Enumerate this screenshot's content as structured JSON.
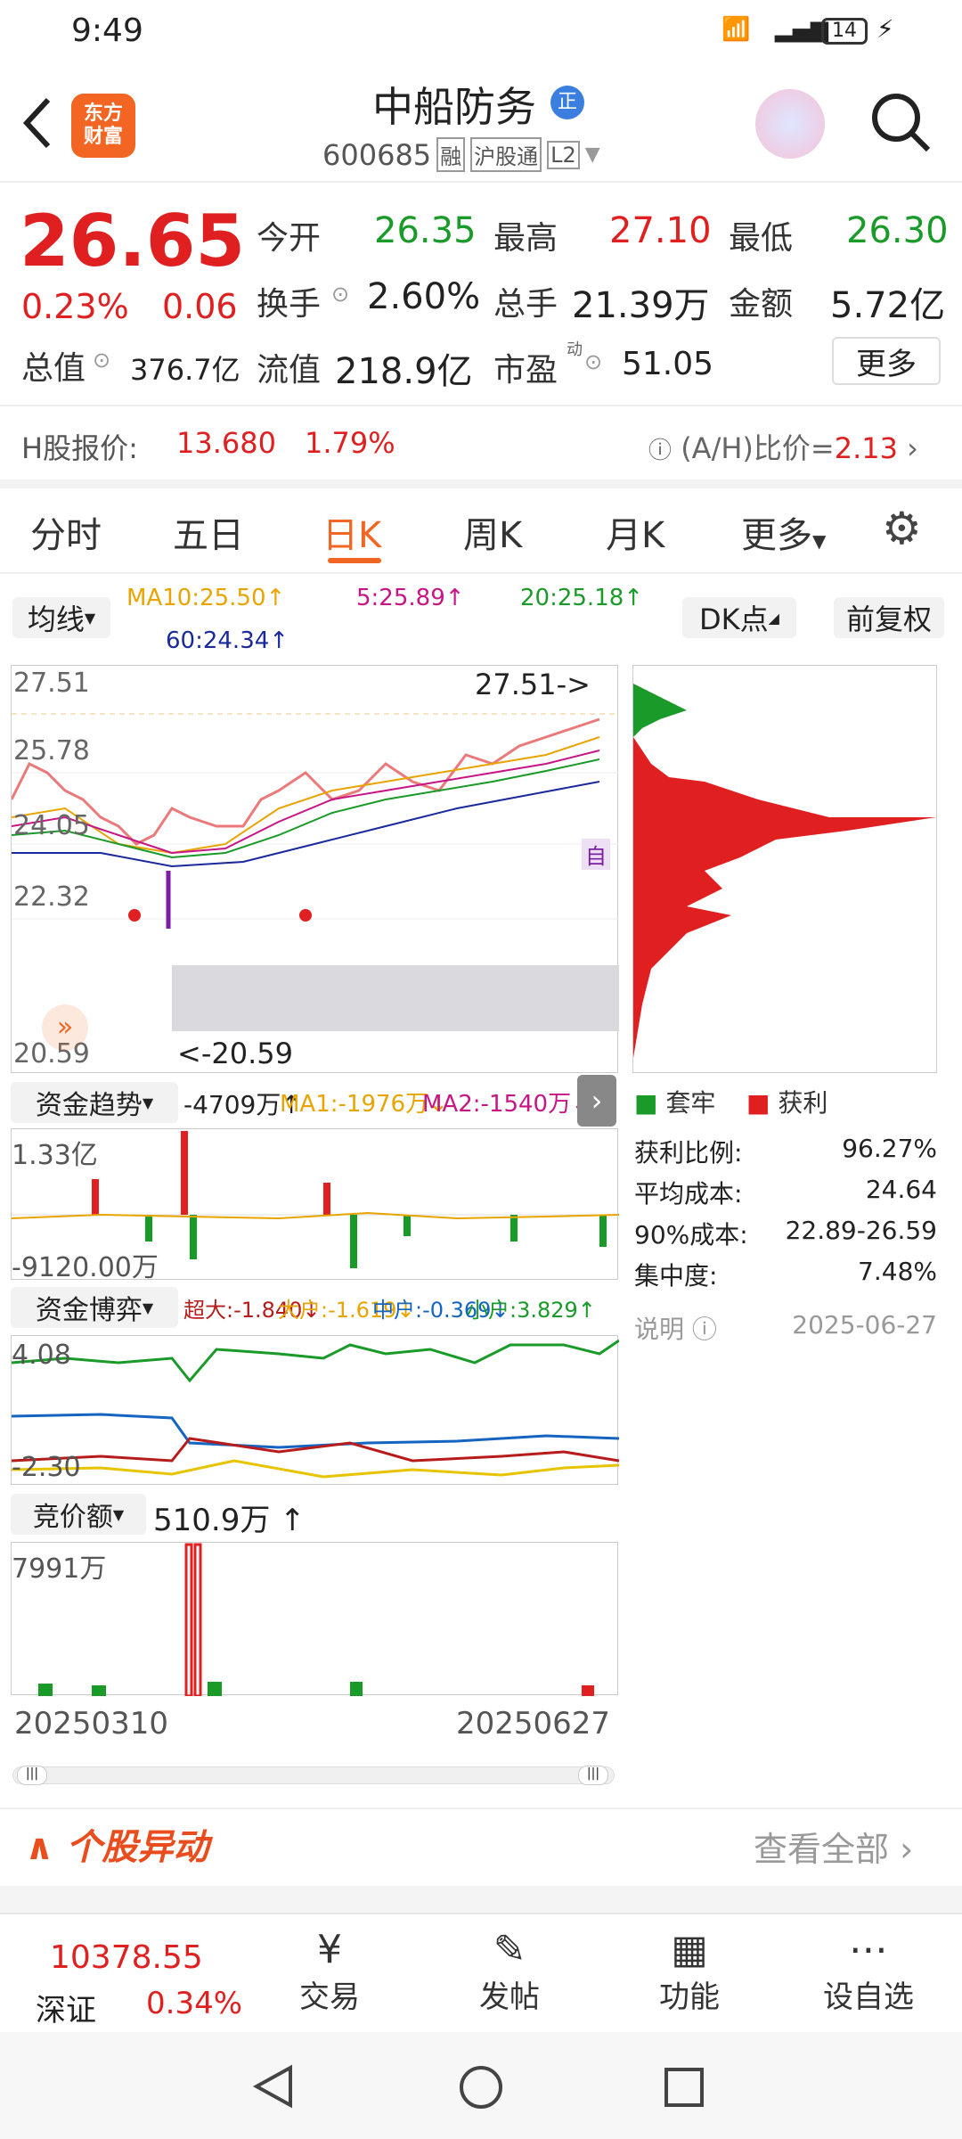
{
  "status": {
    "time": "9:49",
    "battery": "14"
  },
  "header": {
    "name": "中船防务",
    "name_badge": "正",
    "code": "600685",
    "tags": [
      "融",
      "沪股通",
      "L2"
    ],
    "logo_line1": "东方",
    "logo_line2": "财富"
  },
  "quote": {
    "price": "26.65",
    "pct": "0.23%",
    "chg": "0.06",
    "open_label": "今开",
    "open": "26.35",
    "high_label": "最高",
    "high": "27.10",
    "low_label": "最低",
    "low": "26.30",
    "turnover_label": "换手",
    "turnover": "2.60%",
    "volume_label": "总手",
    "volume": "21.39万",
    "amount_label": "金额",
    "amount": "5.72亿",
    "mktcap_label": "总值",
    "mktcap": "376.7亿",
    "float_label": "流值",
    "float": "218.9亿",
    "pe_label": "市盈",
    "pe_sup": "动",
    "pe": "51.05",
    "more": "更多"
  },
  "hshare": {
    "label": "H股报价:",
    "price": "13.680",
    "pct": "1.79%",
    "ah_label": "(A/H)比价=",
    "ah": "2.13"
  },
  "tabs": [
    "分时",
    "五日",
    "日K",
    "周K",
    "月K",
    "更多"
  ],
  "active_tab": "日K",
  "ma": {
    "selector": "均线",
    "ma10": "MA10:25.50↑",
    "ma5": "5:25.89↑",
    "ma20": "20:25.18↑",
    "ma60": "60:24.34↑",
    "dk": "DK点",
    "fq": "前复权"
  },
  "kline": {
    "y_labels": [
      "27.51",
      "25.78",
      "24.05",
      "22.32",
      "20.59"
    ],
    "max_marker": "27.51->",
    "min_marker": "<-20.59",
    "tag": "自"
  },
  "capflow": {
    "title": "资金趋势",
    "value": "-4709万↑",
    "ma1": "MA1:-1976万↓",
    "ma2": "MA2:-1540万↓",
    "top": "1.33亿",
    "bottom": "-9120.00万"
  },
  "game": {
    "title": "资金博弈",
    "super": "超大:-1.840↓",
    "big": "大户:-1.619↓",
    "mid": "中户:-0.369↓",
    "small": "小户:3.829↑",
    "top": "4.08",
    "bottom": "-2.30"
  },
  "auction": {
    "title": "竞价额",
    "value": "510.9万",
    "top": "7991万",
    "start": "20250310",
    "end": "20250627"
  },
  "chips": {
    "legend_trap": "套牢",
    "legend_profit": "获利",
    "rows": [
      {
        "k": "获利比例:",
        "v": "96.27%"
      },
      {
        "k": "平均成本:",
        "v": "24.64"
      },
      {
        "k": "90%成本:",
        "v": "22.89-26.59"
      },
      {
        "k": "集中度:",
        "v": "7.48%"
      }
    ],
    "note": "说明",
    "date": "2025-06-27"
  },
  "movement": {
    "title": "个股异动",
    "more": "查看全部"
  },
  "bottom_nav": {
    "index_value": "10378.55",
    "index_name": "深证",
    "index_pct": "0.34%",
    "items": [
      "交易",
      "发帖",
      "功能",
      "设自选"
    ]
  },
  "colors": {
    "red": "#e02020",
    "green": "#1a9a28",
    "orange": "#f26522",
    "ma5": "#c71585",
    "ma10": "#e8a400",
    "ma20": "#1a9a28",
    "ma60": "#1a2a9a"
  }
}
